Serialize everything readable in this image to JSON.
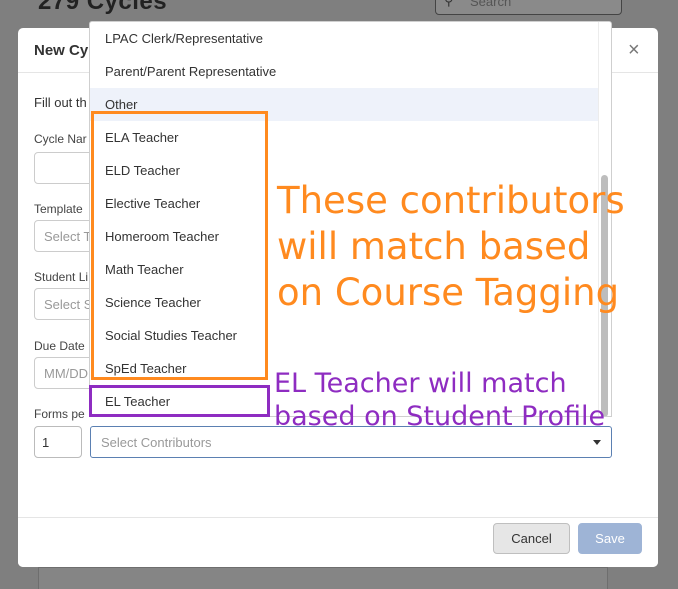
{
  "background": {
    "page_title": "279 Cycles",
    "search_placeholder": "Search",
    "search_icon": "search-icon"
  },
  "modal": {
    "title": "New Cy",
    "close_glyph": "×",
    "intro_text": "Fill out th",
    "fields": {
      "cycle_name_label": "Cycle Nar",
      "template_label": "Template",
      "template_placeholder": "Select T",
      "student_list_label": "Student Li",
      "student_list_placeholder": "Select S",
      "due_date_label": "Due Date",
      "due_date_placeholder": "MM/DD",
      "forms_per_label": "Forms pe",
      "forms_per_value": "1",
      "contributors_placeholder": "Select Contributors"
    },
    "footer": {
      "cancel_label": "Cancel",
      "save_label": "Save"
    }
  },
  "dropdown": {
    "options": [
      "LPAC Clerk/Representative",
      "Parent/Parent Representative",
      "Other",
      "ELA Teacher",
      "ELD Teacher",
      "Elective Teacher",
      "Homeroom Teacher",
      "Math Teacher",
      "Science Teacher",
      "Social Studies Teacher",
      "SpEd Teacher",
      "EL Teacher"
    ],
    "highlighted": "Other"
  },
  "annotations": {
    "orange_note_lines": [
      "These contributors",
      "will match based",
      "on Course Tagging"
    ],
    "purple_note_lines": [
      "EL Teacher will match",
      "based on Student Profile"
    ],
    "colors": {
      "orange": "#ff8a1f",
      "purple": "#8e2cc1"
    }
  },
  "colors": {
    "save_button": "#9eb4d6",
    "active_border": "#5b80b2",
    "highlight_row": "#eef2fa",
    "overlay": "#7f7f7f"
  }
}
